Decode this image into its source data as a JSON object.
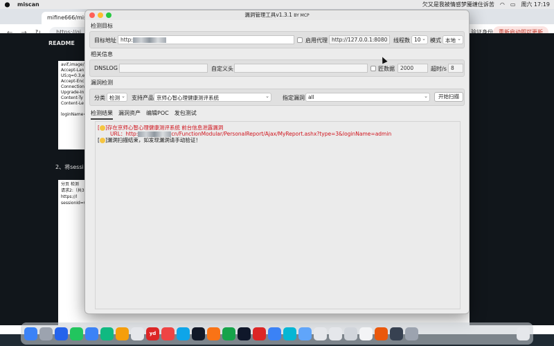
{
  "menubar": {
    "app_name": "miscan",
    "song": "欠又是我被情感梦魇缠住诉苦",
    "clock": "周六 17:19"
  },
  "browser": {
    "tab_title": "mifine666/miscan",
    "url_text": "https://gi",
    "auth_label": "验证身份",
    "update_label": "重新启动即可更新",
    "readme_label": "README",
    "code_lines": [
      "avif,image/w",
      "Accept-Lan",
      "US;q=0.3,e",
      "Accept-Enc",
      "Connection",
      "Upgrade-In",
      "Content-Ty",
      "Content-Le",
      "",
      "loginName="
    ],
    "section_text": "2、将sessi",
    "shot2": {
      "tab": "分页",
      "select": "检测",
      "req": "请求2:（共3",
      "l1": "https://l",
      "l2": "sessionId=("
    }
  },
  "app": {
    "title": "漏洞管理工具v1.3.1",
    "title_by": "BY MCP",
    "section_target": "检测目标",
    "target_label": "目标地址",
    "target_value": "http:",
    "proxy_label": "启用代理",
    "proxy_value": "http://127.0.0.1:8080",
    "threads_label": "线程数",
    "threads_value": "10",
    "mode_label": "模式",
    "mode_value": "本地",
    "section_info": "相关信息",
    "dnslog_label": "DNSLOG",
    "header_label": "自定义头",
    "spider_label": "匠数据",
    "spider_value": "2000",
    "timeout_label": "超时/s",
    "timeout_value": "8",
    "section_vuln": "漏洞检测",
    "category_label": "分类",
    "category_value": "检测",
    "product_label": "支持产品",
    "product_value": "京师心智心理健康测评系统",
    "vuln_label": "指定漏洞",
    "vuln_value": "all",
    "scan_button": "开始扫描",
    "tabs": [
      "检测结果",
      "漏洞资产",
      "编辑POC",
      "发包测试"
    ],
    "output": {
      "line1": "[",
      "line1_close": "]存在京师心智心理健康测评系统 前台信息泄露漏洞",
      "line2_prefix": "URL：http:",
      "line2_suffix": "cn/FunctionModular/PersonalReport/Ajax/MyReport.ashx?type=3&loginName=admin",
      "line3_open": "[",
      "line3": "]漏洞扫描结束，如发现漏洞请手动验证！"
    }
  },
  "colors": {
    "red": "#d0121b",
    "close": "#ff5f57",
    "minimize": "#febc2e",
    "maximize": "#28c840"
  },
  "dock": {
    "items": [
      "finder-icon",
      "launchpad-icon",
      "safari-icon",
      "messages-icon",
      "mail-icon",
      "maps-icon",
      "photos-icon",
      "reminders-icon",
      "youdao-icon",
      "chrome-icon",
      "edge-icon",
      "terminal-icon",
      "brave-icon",
      "wechat-icon",
      "qq-icon",
      "netease-music-icon",
      "baidu-netdisk-icon",
      "feishu-icon",
      "app-icon",
      "app-icon-2",
      "app-icon-3",
      "app-icon-4",
      "app-icon-5",
      "firefox-icon",
      "app-icon-6",
      "app-icon-7",
      "trash-icon"
    ],
    "yd_label": "yd"
  }
}
